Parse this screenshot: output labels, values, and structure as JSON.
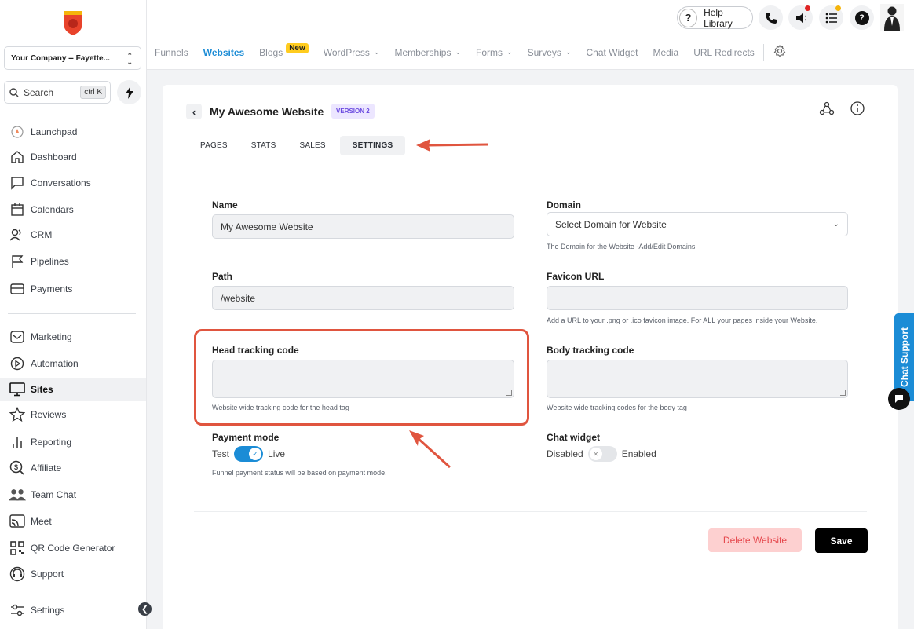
{
  "sidebar": {
    "company": "Your Company -- Fayette...",
    "search_label": "Search",
    "search_shortcut": "ctrl K",
    "items": [
      {
        "label": "Launchpad",
        "icon": "rocket-icon"
      },
      {
        "label": "Dashboard",
        "icon": "home-icon"
      },
      {
        "label": "Conversations",
        "icon": "chat-icon"
      },
      {
        "label": "Calendars",
        "icon": "calendar-icon"
      },
      {
        "label": "CRM",
        "icon": "contacts-icon"
      },
      {
        "label": "Pipelines",
        "icon": "flag-icon"
      },
      {
        "label": "Payments",
        "icon": "wallet-icon"
      },
      {
        "label": "Marketing",
        "icon": "mail-icon"
      },
      {
        "label": "Automation",
        "icon": "play-icon"
      },
      {
        "label": "Sites",
        "icon": "monitor-icon"
      },
      {
        "label": "Reviews",
        "icon": "star-icon"
      },
      {
        "label": "Reporting",
        "icon": "bar-chart-icon"
      },
      {
        "label": "Affiliate",
        "icon": "dollar-search-icon"
      },
      {
        "label": "Team Chat",
        "icon": "team-icon"
      },
      {
        "label": "Meet",
        "icon": "cast-icon"
      },
      {
        "label": "QR Code Generator",
        "icon": "qr-icon"
      },
      {
        "label": "Support",
        "icon": "headset-icon"
      },
      {
        "label": "Settings",
        "icon": "settings-sliders-icon"
      }
    ]
  },
  "topbar": {
    "help_label": "Help Library",
    "notify_red": "#e02424",
    "notify_yellow": "#f5b40b"
  },
  "tabs": [
    {
      "label": "Funnels"
    },
    {
      "label": "Websites"
    },
    {
      "label": "Blogs"
    },
    {
      "label": "WordPress"
    },
    {
      "label": "Memberships"
    },
    {
      "label": "Forms"
    },
    {
      "label": "Surveys"
    },
    {
      "label": "Chat Widget"
    },
    {
      "label": "Media"
    },
    {
      "label": "URL Redirects"
    }
  ],
  "new_badge": "New",
  "page": {
    "title": "My Awesome Website",
    "version": "VERSION 2",
    "subtabs": [
      "PAGES",
      "STATS",
      "SALES",
      "SETTINGS"
    ]
  },
  "form": {
    "name_label": "Name",
    "name_value": "My Awesome Website",
    "domain_label": "Domain",
    "domain_value": "Select Domain for Website",
    "domain_hint": "The Domain for the Website -Add/Edit Domains",
    "path_label": "Path",
    "path_value": "/website",
    "favicon_label": "Favicon URL",
    "favicon_hint": "Add a URL to your .png or .ico favicon image. For ALL your pages inside your Website.",
    "head_label": "Head tracking code",
    "head_hint": "Website wide tracking code for the head tag",
    "body_label": "Body tracking code",
    "body_hint": "Website wide tracking codes for the body tag",
    "payment_label": "Payment mode",
    "payment_left": "Test",
    "payment_right": "Live",
    "payment_hint": "Funnel payment status will be based on payment mode.",
    "chat_label": "Chat widget",
    "chat_left": "Disabled",
    "chat_right": "Enabled"
  },
  "actions": {
    "delete": "Delete Website",
    "save": "Save"
  },
  "chat_support": "Chat Support",
  "colors": {
    "accent": "#1b8cd6",
    "annotation": "#e0553f"
  }
}
